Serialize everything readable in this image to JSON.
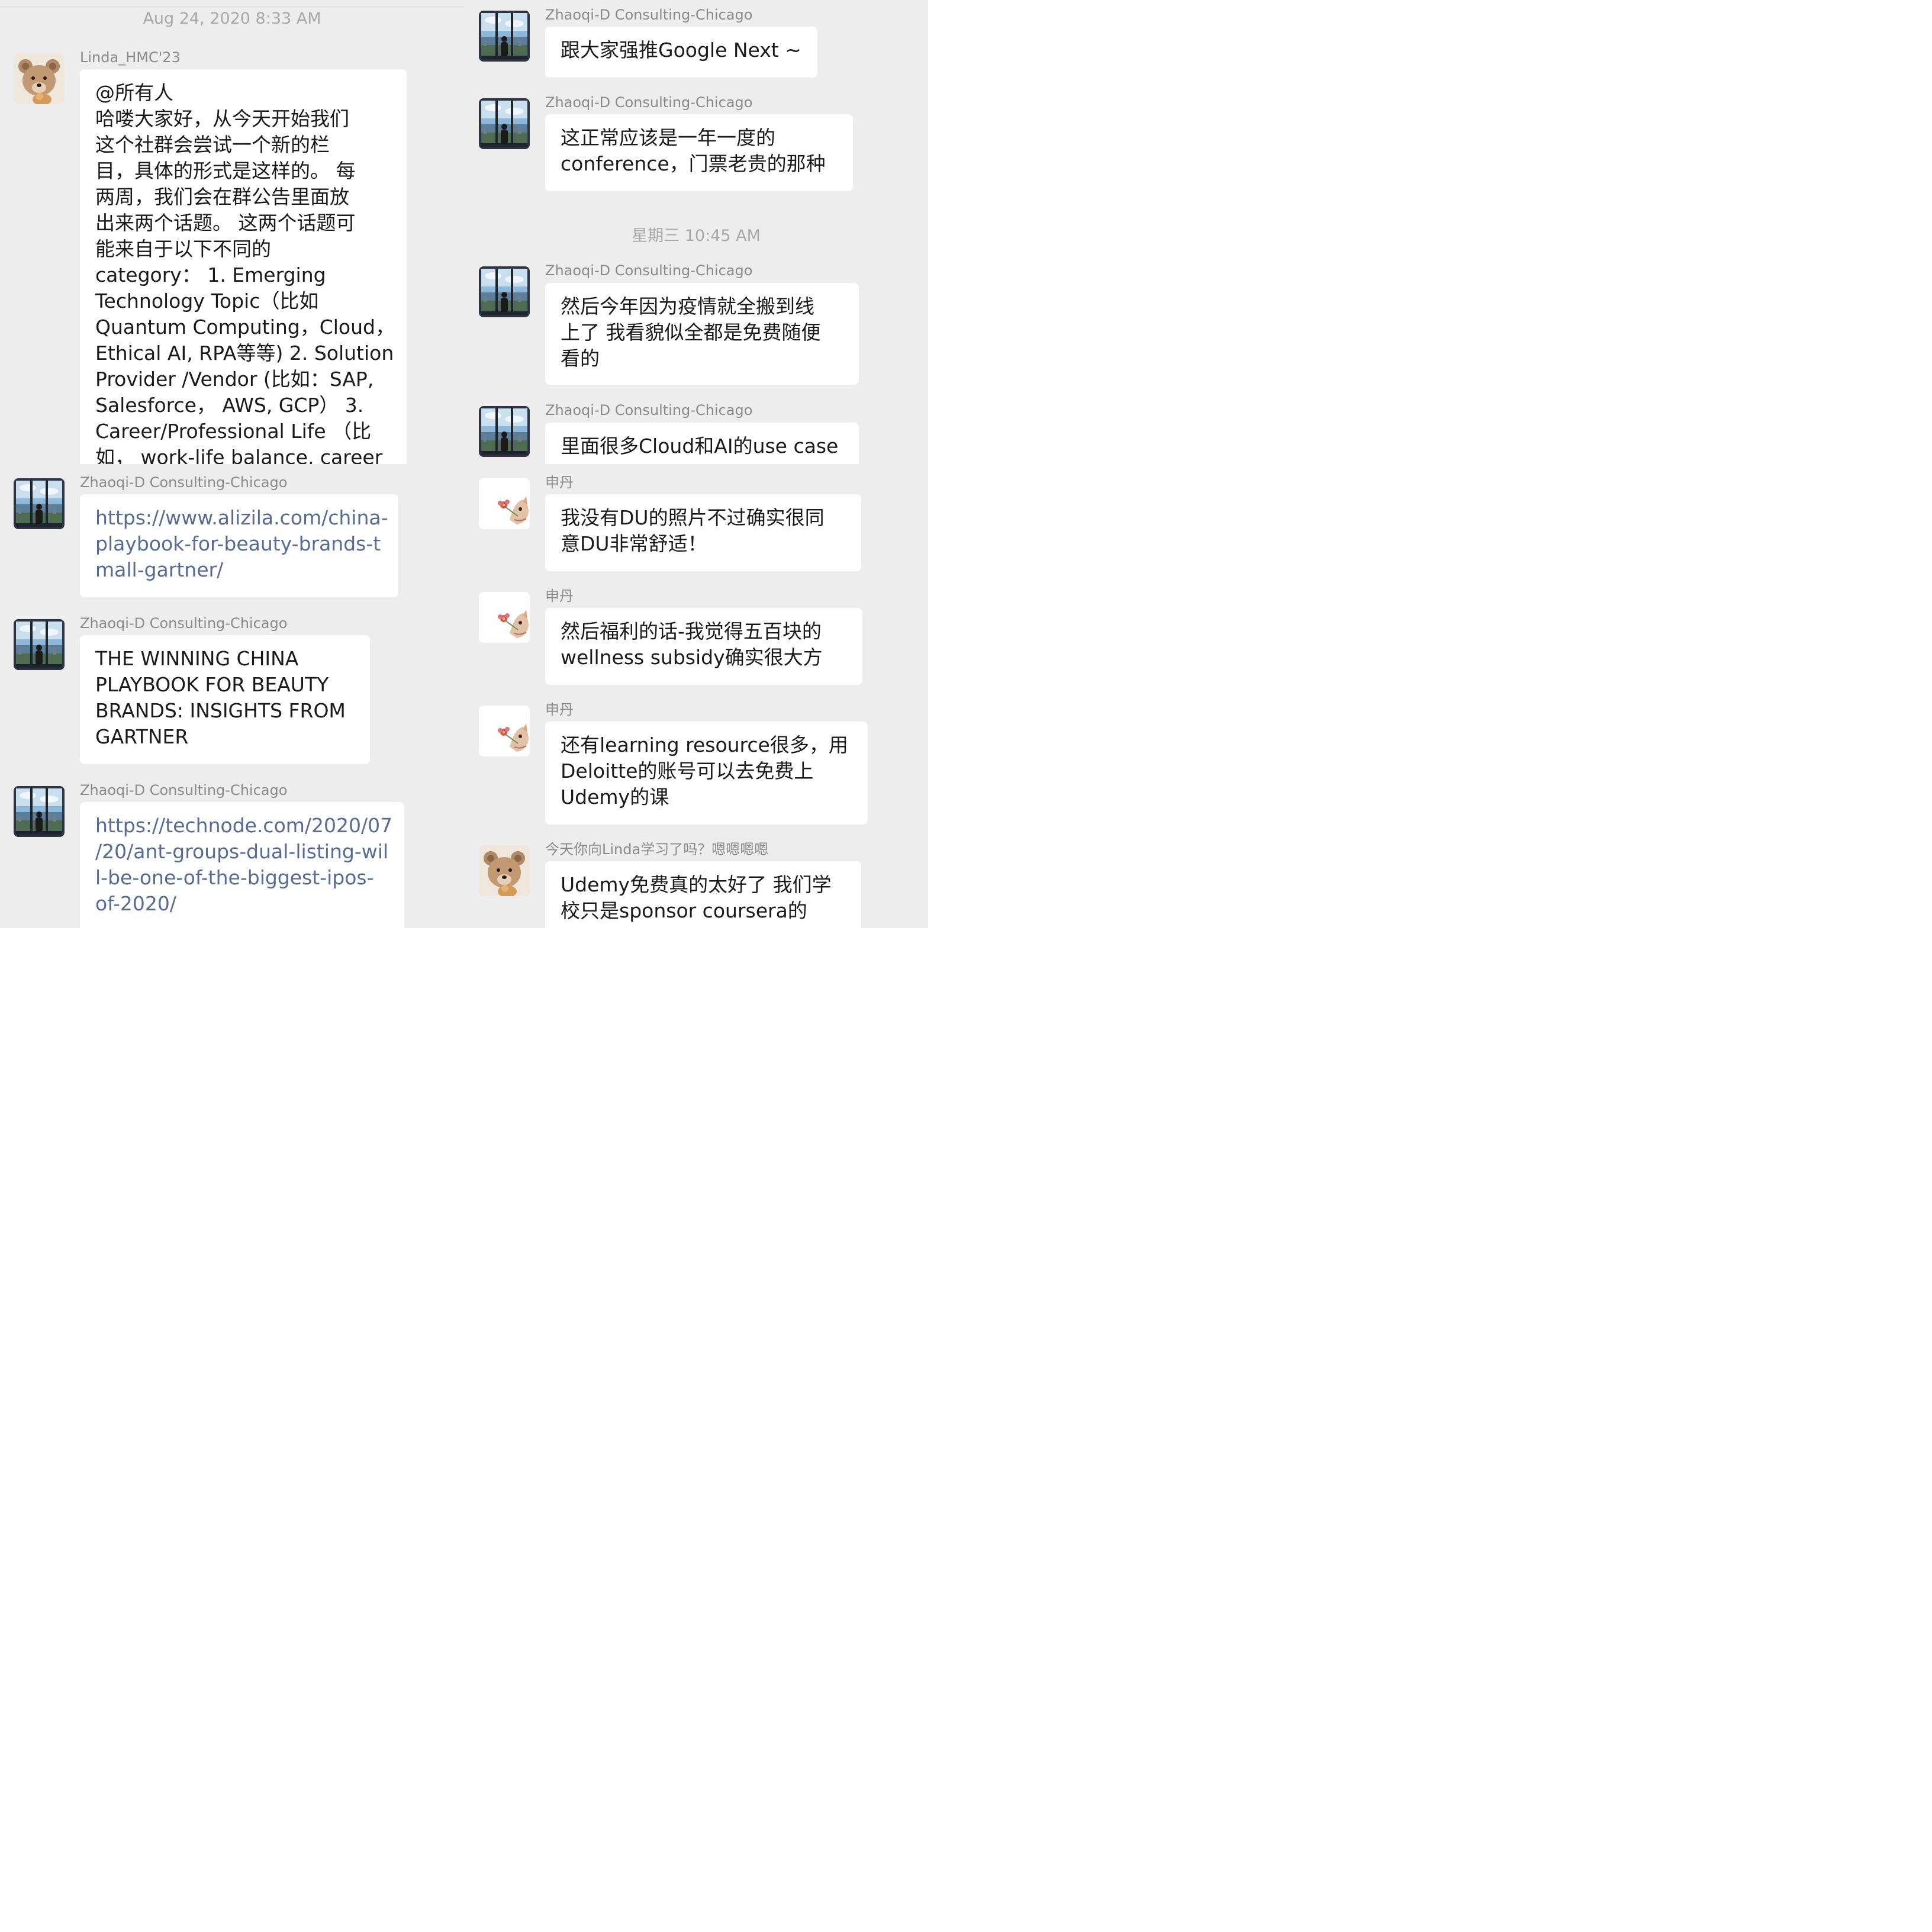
{
  "panel1": {
    "timestamp": "Aug 24, 2020 8:33 AM",
    "message": {
      "sender": "Linda_HMC'23",
      "lines": [
        "@所有人",
        "哈喽大家好，从今天开始我们",
        "这个社群会尝试一个新的栏",
        "目，具体的形式是这样的。 每",
        "两周，我们会在群公告里面放",
        "出来两个话题。 这两个话题可",
        "能来自于以下不同的",
        "category： 1. Emerging",
        "Technology Topic（比如",
        "Quantum Computing，Cloud，",
        "Ethical AI, RPA等等) 2. Solution",
        " Provider /Vendor (比如：SAP,",
        "Salesforce， AWS, GCP） 3.",
        "Career/Professional Life （比",
        "如， work-life balance, career"
      ]
    }
  },
  "panel2": {
    "timestamp": "星期三 10:45 AM",
    "messages": [
      {
        "sender": "Zhaoqi-D Consulting-Chicago",
        "lines": [
          "跟大家强推Google Next ~"
        ]
      },
      {
        "sender": "Zhaoqi-D Consulting-Chicago",
        "lines": [
          "这正常应该是一年一度的",
          "conference，门票老贵的那种"
        ]
      },
      {
        "sender": "Zhaoqi-D Consulting-Chicago",
        "lines": [
          "然后今年因为疫情就全搬到线",
          "上了 我看貌似全都是免费随便",
          "看的"
        ]
      },
      {
        "sender": "Zhaoqi-D Consulting-Chicago",
        "lines": [
          "里面很多Cloud和AI的use case"
        ]
      }
    ]
  },
  "panel3": {
    "messages": [
      {
        "sender": "Zhaoqi-D Consulting-Chicago",
        "lines": [
          "https://www.alizila.com/china-",
          "playbook-for-beauty-brands-t",
          "mall-gartner/"
        ]
      },
      {
        "sender": "Zhaoqi-D Consulting-Chicago",
        "lines": [
          "THE WINNING CHINA",
          "PLAYBOOK FOR BEAUTY",
          "BRANDS: INSIGHTS FROM",
          "GARTNER"
        ]
      },
      {
        "sender": "Zhaoqi-D Consulting-Chicago",
        "lines": [
          "https://technode.com/2020/07",
          "/20/ant-groups-dual-listing-wil",
          "l-be-one-of-the-biggest-ipos-",
          "of-2020/"
        ]
      }
    ]
  },
  "panel4": {
    "messages": [
      {
        "sender": "申丹",
        "lines": [
          "我没有DU的照片不过确实很同",
          "意DU非常舒适！"
        ]
      },
      {
        "sender": "申丹",
        "lines": [
          "然后福利的话-我觉得五百块的",
          "wellness subsidy确实很大方"
        ]
      },
      {
        "sender": "申丹",
        "lines": [
          "还有learning resource很多，用",
          "Deloitte的账号可以去免费上",
          "Udemy的课"
        ]
      },
      {
        "sender": "今天你向Linda学习了吗？嗯嗯嗯嗯",
        "lines": [
          "Udemy免费真的太好了 我们学",
          "校只是sponsor coursera的"
        ]
      }
    ]
  },
  "colors": {
    "background": "#ededed",
    "bubble": "#ffffff",
    "link": "#576b95",
    "sender": "#8a8a8a"
  }
}
